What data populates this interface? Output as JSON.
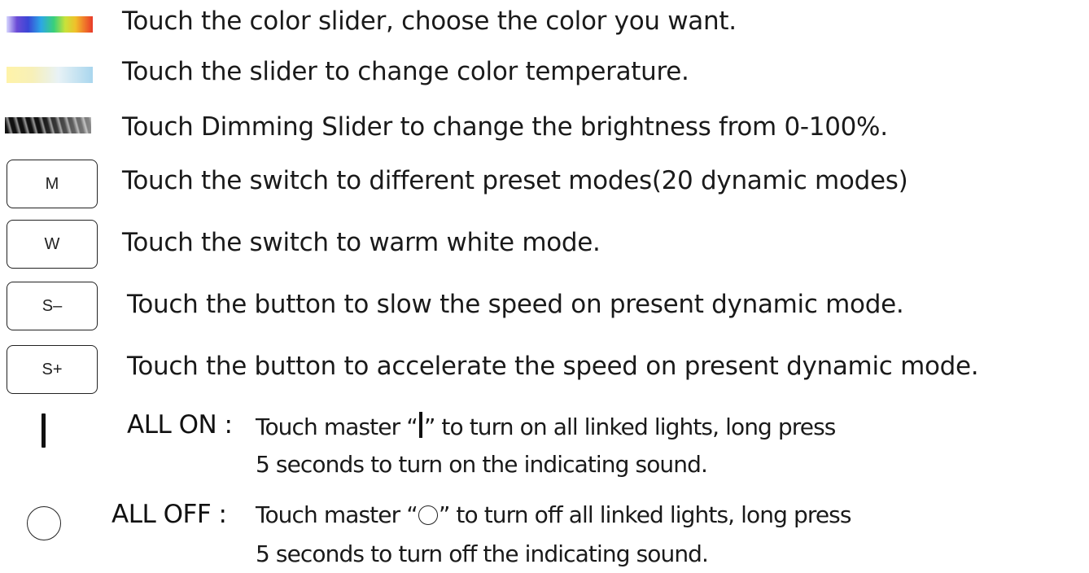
{
  "rows": [
    {
      "icon": "color-slider",
      "text": "Touch the color slider, choose the color you want."
    },
    {
      "icon": "temperature-slider",
      "text": "Touch the slider to change color temperature."
    },
    {
      "icon": "dimming-slider",
      "text": "Touch Dimming Slider to change the brightness from 0-100%."
    },
    {
      "icon": "key",
      "key_label": "M",
      "text": "Touch the switch to different preset modes(20 dynamic modes)"
    },
    {
      "icon": "key",
      "key_label": "W",
      "text": "Touch the switch to warm white mode."
    },
    {
      "icon": "key",
      "key_label": "S–",
      "text": "Touch the button to slow the speed on present dynamic mode."
    },
    {
      "icon": "key",
      "key_label": "S+",
      "text": "Touch the button to accelerate the speed on present dynamic mode."
    }
  ],
  "all_on": {
    "heading": "ALL ON :",
    "line1_pre": "Touch master “",
    "line1_post": "” to turn on all linked lights, long press",
    "line2": "5 seconds to turn on the indicating sound."
  },
  "all_off": {
    "heading": "ALL OFF :",
    "line1_pre": "Touch master “",
    "line1_post": "” to turn off all linked lights, long press",
    "line2": "5 seconds to turn off the indicating sound."
  }
}
